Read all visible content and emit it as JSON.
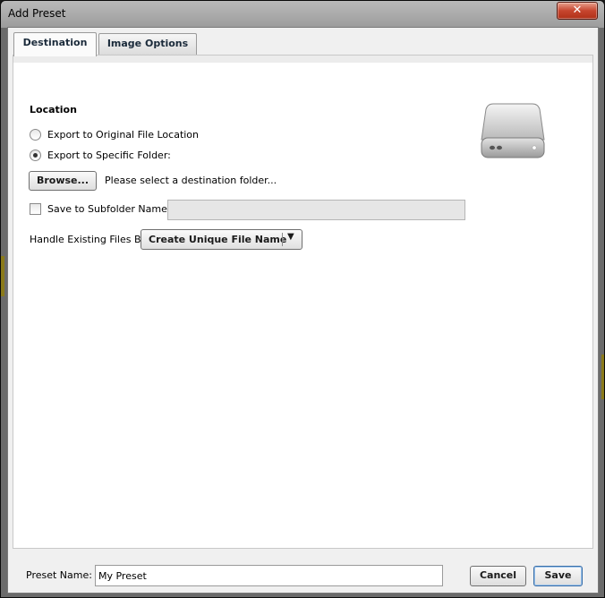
{
  "window": {
    "title": "Add Preset",
    "close_glyph": "✕"
  },
  "tabs": [
    {
      "label": "Destination",
      "active": true
    },
    {
      "label": "Image Options",
      "active": false
    }
  ],
  "location": {
    "section_title": "Location",
    "options": [
      {
        "label": "Export to Original File Location",
        "checked": false
      },
      {
        "label": "Export to Specific Folder:",
        "checked": true
      }
    ],
    "browse_label": "Browse...",
    "browse_hint": "Please select a destination folder...",
    "subfolder": {
      "label": "Save to Subfolder Named",
      "checked": false,
      "value": ""
    },
    "handle_existing": {
      "label": "Handle Existing Files By",
      "selected": "Create Unique File Name"
    },
    "drive_icon": "hard-drive-icon"
  },
  "footer": {
    "preset_name_label": "Preset Name:",
    "preset_name_value": "My Preset",
    "cancel_label": "Cancel",
    "save_label": "Save"
  },
  "colors": {
    "close_button": "#c6452e",
    "default_button_border": "#3a6ea8"
  }
}
